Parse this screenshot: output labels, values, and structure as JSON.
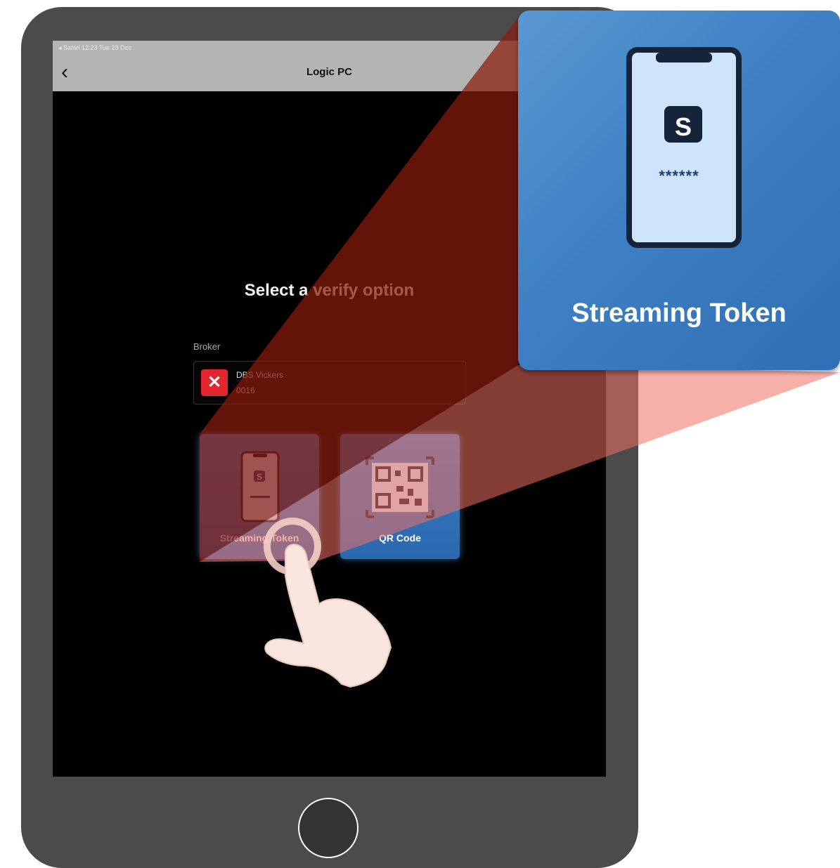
{
  "status_bar": {
    "text": "◂ Safari  12:23   Tue 23 Dec"
  },
  "nav": {
    "back_glyph": "‹",
    "title": "Logic PC"
  },
  "main": {
    "heading": "Select a verify option",
    "broker_label": "Broker",
    "broker": {
      "name": "DBS Vickers",
      "code": "0016",
      "logo_glyph": "✕"
    },
    "options": [
      {
        "label": "Streaming Token"
      },
      {
        "label": "QR Code"
      }
    ]
  },
  "callout": {
    "label": "Streaming Token",
    "masked_code": "******"
  },
  "colors": {
    "overlay_red": "#8b1a0c",
    "callout_blue": "#3f80c4",
    "broker_red": "#e3262e"
  },
  "icons": [
    "back-chevron-icon",
    "phone-token-icon",
    "qr-code-icon",
    "tap-hand-icon",
    "app-logo-icon"
  ]
}
